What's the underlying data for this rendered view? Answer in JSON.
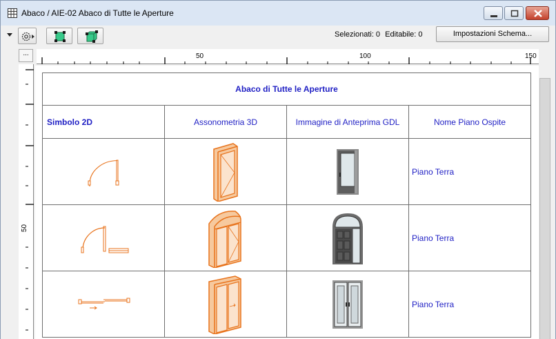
{
  "window": {
    "title": "Abaco / AIE-02 Abaco di Tutte le Aperture",
    "icon": "schedule-icon"
  },
  "toolbar": {
    "selected_label": "Selezionati: 0",
    "editable_label": "Editabile: 0",
    "schema_button": "Impostazioni Schema..."
  },
  "rulers": {
    "corner_label": "...",
    "horizontal_marks": [
      "50",
      "100",
      "150"
    ],
    "vertical_marks": [
      "50"
    ]
  },
  "schedule": {
    "title": "Abaco di Tutte le Aperture",
    "columns": [
      "Simbolo 2D",
      "Assonometria 3D",
      "Immagine di Anteprima GDL",
      "Nome Piano Ospite"
    ],
    "rows": [
      {
        "symbol": "single-door-swing-icon",
        "axon": "single-door-3d-icon",
        "preview": "single-door-preview-icon",
        "host_story": "Piano Terra"
      },
      {
        "symbol": "arched-door-swing-icon",
        "axon": "arched-double-door-3d-icon",
        "preview": "arched-door-preview-icon",
        "host_story": "Piano Terra"
      },
      {
        "symbol": "sliding-door-icon",
        "axon": "double-door-3d-icon",
        "preview": "double-door-preview-icon",
        "host_story": "Piano Terra"
      }
    ]
  },
  "colors": {
    "accent_text": "#1f1fc4",
    "element_orange": "#e8731c",
    "grid_line": "#6e6e6e",
    "close_red": "#c4412c"
  }
}
